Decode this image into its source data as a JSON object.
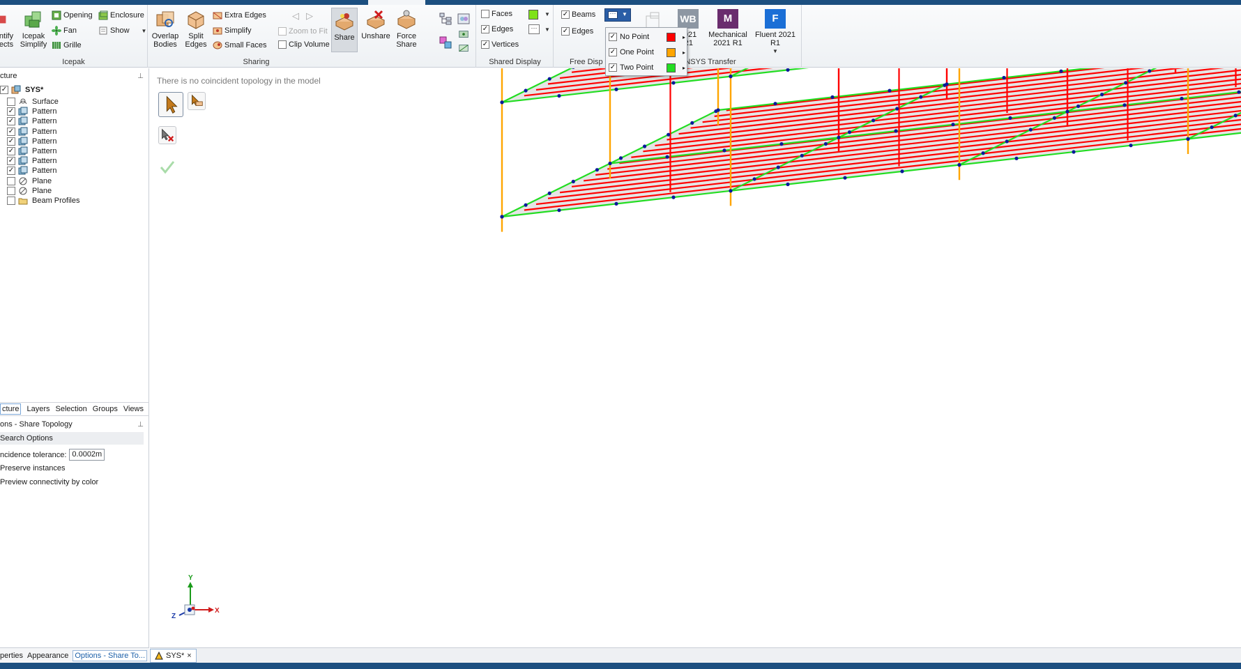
{
  "ribbon": {
    "icepak": {
      "group_label": "Icepak",
      "identify_label_1": "ntify",
      "identify_label_2": "ects",
      "icepak_simplify_1": "Icepak",
      "icepak_simplify_2": "Simplify",
      "opening": "Opening",
      "enclosure": "Enclosure",
      "fan": "Fan",
      "show": "Show",
      "grille": "Grille"
    },
    "sharing": {
      "group_label": "Sharing",
      "overlap_1": "Overlap",
      "overlap_2": "Bodies",
      "split_1": "Split",
      "split_2": "Edges",
      "extra_edges": "Extra Edges",
      "simplify": "Simplify",
      "small_faces": "Small Faces",
      "zoom_to_fit": "Zoom to Fit",
      "clip_volume": "Clip Volume",
      "share": "Share",
      "unshare": "Unshare",
      "force_1": "Force",
      "force_2": "Share"
    },
    "shared_display": {
      "group_label": "Shared Display",
      "faces": "Faces",
      "edges": "Edges",
      "vertices": "Vertices",
      "faces_checked": false,
      "edges_checked": true,
      "vertices_checked": true,
      "faces_color": "#7fe21a"
    },
    "free_display": {
      "group_label": "Free Disp",
      "beams": "Beams",
      "edges": "Edges",
      "beams_checked": true,
      "edges_checked": true
    },
    "point_popup": {
      "items": [
        {
          "label": "No Point",
          "checked": true,
          "color": "#ff0000"
        },
        {
          "label": "One Point",
          "checked": true,
          "color": "#ffa500"
        },
        {
          "label": "Two Point",
          "checked": true,
          "color": "#22dd22"
        }
      ]
    },
    "ansys_transfer": {
      "group_label": "ANSYS Transfer",
      "wb_badge": "WB",
      "wb_1": "2021",
      "wb_2": "R1",
      "mech_badge": "M",
      "mech_1": "Mechanical",
      "mech_2": "2021 R1",
      "fluent_badge": "F",
      "fluent_1": "Fluent 2021",
      "fluent_2": "R1"
    }
  },
  "structure": {
    "header": "cture",
    "root": "SYS*",
    "items": [
      {
        "label": "Surface",
        "checked": false,
        "icon": "surface-icon"
      },
      {
        "label": "Pattern",
        "checked": true,
        "icon": "pattern-icon"
      },
      {
        "label": "Pattern",
        "checked": true,
        "icon": "pattern-icon"
      },
      {
        "label": "Pattern",
        "checked": true,
        "icon": "pattern-icon"
      },
      {
        "label": "Pattern",
        "checked": true,
        "icon": "pattern-icon"
      },
      {
        "label": "Pattern",
        "checked": true,
        "icon": "pattern-icon"
      },
      {
        "label": "Pattern",
        "checked": true,
        "icon": "pattern-icon"
      },
      {
        "label": "Pattern",
        "checked": true,
        "icon": "pattern-icon"
      },
      {
        "label": "Plane",
        "checked": false,
        "icon": "plane-icon"
      },
      {
        "label": "Plane",
        "checked": false,
        "icon": "plane-icon"
      },
      {
        "label": "Beam Profiles",
        "checked": false,
        "icon": "folder-icon"
      }
    ]
  },
  "panel_tabs": [
    "cture",
    "Layers",
    "Selection",
    "Groups",
    "Views"
  ],
  "options": {
    "header": "ons - Share Topology",
    "section": "Search Options",
    "tolerance_label": "ncidence tolerance:",
    "tolerance_value": "0.0002m",
    "preserve": "Preserve instances",
    "preview": "Preview connectivity by color"
  },
  "bottom_tabs": [
    "perties",
    "Appearance",
    "Options - Share To..."
  ],
  "viewport": {
    "message": "There is no coincident topology in the model",
    "triad_x": "X",
    "triad_y": "Y",
    "triad_z": "Z"
  },
  "doc_tab": {
    "label": "SYS*",
    "close": "×"
  },
  "colors": {
    "no_point": "#ff0000",
    "one_point": "#ffa500",
    "two_point": "#22dd22",
    "vertex": "#0a1a9a",
    "face": "#dcdcdc"
  }
}
